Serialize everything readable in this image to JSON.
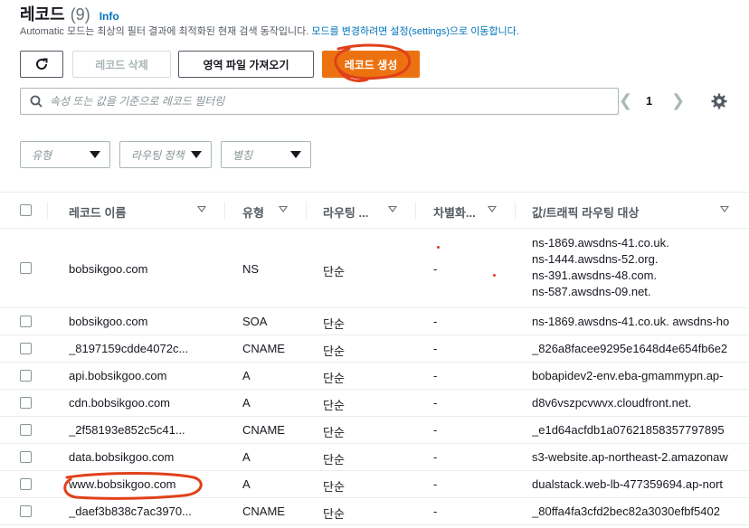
{
  "header": {
    "title": "레코드",
    "count": "(9)",
    "info": "Info",
    "description_prefix": "Automatic 모드는 최상의 필터 결과에 최적화된 현재 검색 동작입니다.",
    "description_link": "모드를 변경하려면 설정(settings)으로 이동합니다."
  },
  "toolbar": {
    "delete_label": "레코드 삭제",
    "import_label": "영역 파일 가져오기",
    "create_label": "레코드 생성"
  },
  "search": {
    "placeholder": "속성 또는 값을 기준으로 레코드 필터링"
  },
  "pagination": {
    "current_page": "1"
  },
  "filters": [
    {
      "label": "유형"
    },
    {
      "label": "라우팅 정책"
    },
    {
      "label": "별칭"
    }
  ],
  "table": {
    "columns": [
      "레코드 이름",
      "유형",
      "라우팅 ...",
      "차별화...",
      "값/트래픽 라우팅 대상"
    ],
    "rows": [
      {
        "name": "bobsikgoo.com",
        "type": "NS",
        "routing": "단순",
        "diff": "-",
        "values": [
          "ns-1869.awsdns-41.co.uk.",
          "ns-1444.awsdns-52.org.",
          "ns-391.awsdns-48.com.",
          "ns-587.awsdns-09.net."
        ]
      },
      {
        "name": "bobsikgoo.com",
        "type": "SOA",
        "routing": "단순",
        "diff": "-",
        "values": [
          "ns-1869.awsdns-41.co.uk. awsdns-ho"
        ]
      },
      {
        "name": "_8197159cdde4072c...",
        "type": "CNAME",
        "routing": "단순",
        "diff": "-",
        "values": [
          "_826a8facee9295e1648d4e654fb6e2"
        ]
      },
      {
        "name": "api.bobsikgoo.com",
        "type": "A",
        "routing": "단순",
        "diff": "-",
        "values": [
          "bobapidev2-env.eba-gmammypn.ap-"
        ]
      },
      {
        "name": "cdn.bobsikgoo.com",
        "type": "A",
        "routing": "단순",
        "diff": "-",
        "values": [
          "d8v6vszpcvwvx.cloudfront.net."
        ]
      },
      {
        "name": "_2f58193e852c5c41...",
        "type": "CNAME",
        "routing": "단순",
        "diff": "-",
        "values": [
          "_e1d64acfdb1a07621858357797895"
        ]
      },
      {
        "name": "data.bobsikgoo.com",
        "type": "A",
        "routing": "단순",
        "diff": "-",
        "values": [
          "s3-website.ap-northeast-2.amazonaw"
        ]
      },
      {
        "name": "www.bobsikgoo.com",
        "type": "A",
        "routing": "단순",
        "diff": "-",
        "values": [
          "dualstack.web-lb-477359694.ap-nort"
        ]
      },
      {
        "name": "_daef3b838c7ac3970...",
        "type": "CNAME",
        "routing": "단순",
        "diff": "-",
        "values": [
          "_80ffa4fa3cfd2bec82a3030efbf5402"
        ]
      }
    ]
  },
  "colors": {
    "accent": "#ec7211",
    "link": "#0073bb",
    "annotation": "#e0401a"
  }
}
